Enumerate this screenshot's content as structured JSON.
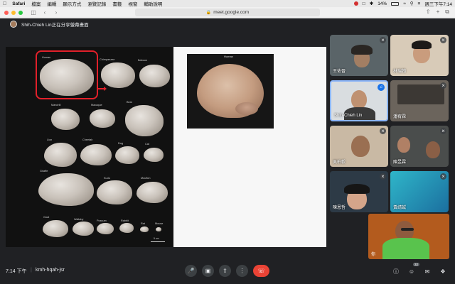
{
  "menubar": {
    "app": "Safari",
    "items": [
      "檔案",
      "編輯",
      "顯示方式",
      "瀏覽記錄",
      "書籤",
      "視窗",
      "輔助說明"
    ],
    "battery": "14%",
    "clock": "週三下午7:14"
  },
  "browser": {
    "url": "meet.google.com"
  },
  "meet": {
    "sharing_banner": "Shih-Chieh Lin正在分享螢幕畫面",
    "time": "7:14 下午",
    "separator": "|",
    "meeting_code": "kmh-hqah-jsr",
    "participant_count": "32"
  },
  "slide": {
    "labels": {
      "human": "Human",
      "chimpanzee": "Chimpanzee",
      "baboon": "Baboon",
      "mandrill": "Mandrill",
      "macaque": "Macaque",
      "bear": "Bear",
      "lion": "Lion",
      "cheetah": "Cheetah",
      "dog": "Dog",
      "cat": "Cat",
      "giraffe": "Giraffe",
      "kudu": "Kudu",
      "mouflon": "Mouflon",
      "goat": "Goat",
      "wallaby": "Wallaby",
      "possum": "Possum",
      "rabbit": "Rabbit",
      "rat": "Rat",
      "mouse": "Mouse",
      "scale": "5 cm"
    },
    "right_label": "Human"
  },
  "participants": [
    {
      "name": "王佑晉"
    },
    {
      "name": "林瑞翰"
    },
    {
      "name": "Shih-Chieh Lin"
    },
    {
      "name": "潘宥霖"
    },
    {
      "name": "吳柏毅"
    },
    {
      "name": "陳昱霖"
    },
    {
      "name": "陳恩哲"
    },
    {
      "name": "黃靖誠"
    }
  ],
  "self_tile": {
    "name": "你"
  }
}
